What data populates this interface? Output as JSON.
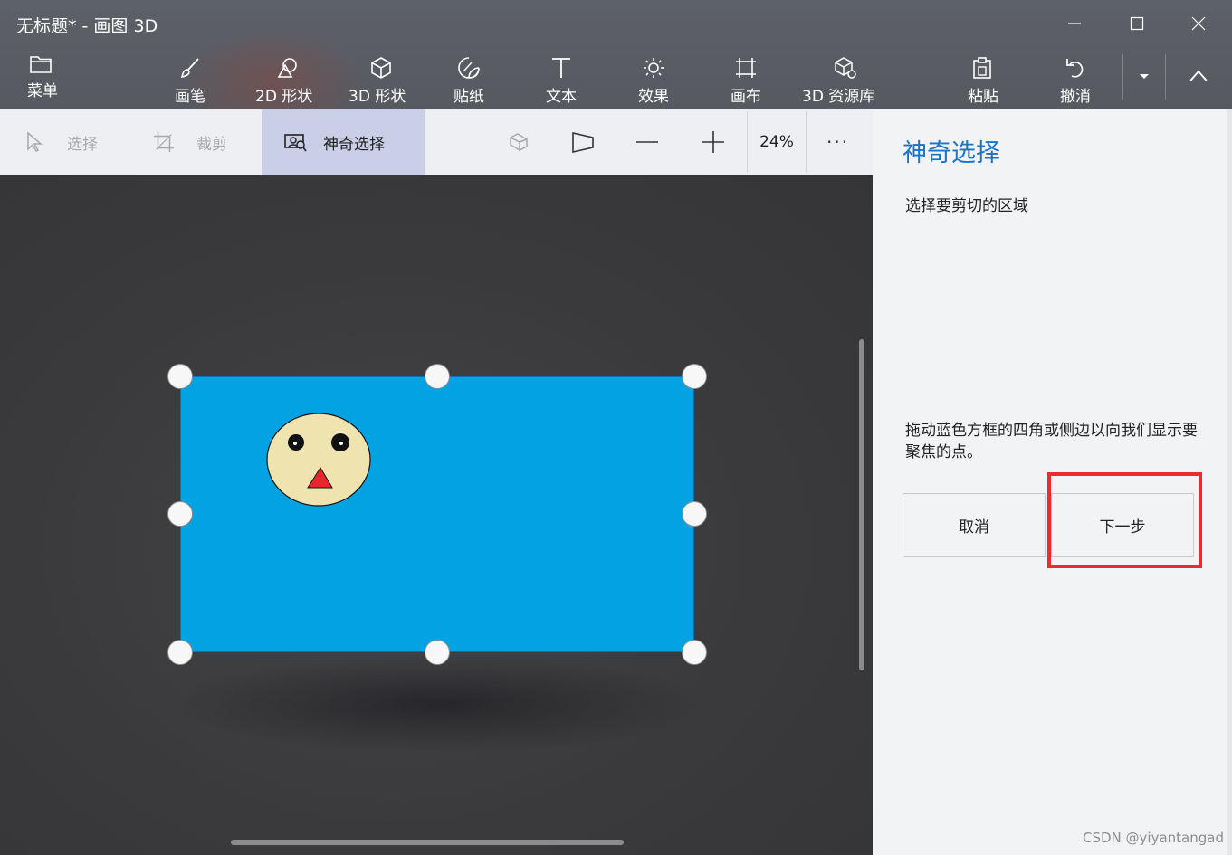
{
  "window": {
    "title": "无标题* - 画图 3D"
  },
  "ribbon": {
    "menu": "菜单",
    "brushes": "画笔",
    "shapes_2d": "2D 形状",
    "shapes_3d": "3D 形状",
    "stickers": "贴纸",
    "text": "文本",
    "effects": "效果",
    "canvas": "画布",
    "library_3d": "3D 资源库",
    "paste": "粘贴",
    "undo": "撤消"
  },
  "toolbar": {
    "select": "选择",
    "crop": "裁剪",
    "magic_select": "神奇选择",
    "zoom": "24%",
    "more": "···"
  },
  "panel": {
    "title": "神奇选择",
    "subtitle": "选择要剪切的区域",
    "hint": "拖动蓝色方框的四角或侧边以向我们显示要聚焦的点。",
    "cancel": "取消",
    "next": "下一步"
  },
  "colors": {
    "accent": "#1c74c6",
    "selection_fill": "#03a2e2",
    "face_fill": "#efe3b0",
    "nose_fill": "#e8262c",
    "highlight": "#ee2a2f"
  },
  "watermark": "CSDN @yiyantangad"
}
